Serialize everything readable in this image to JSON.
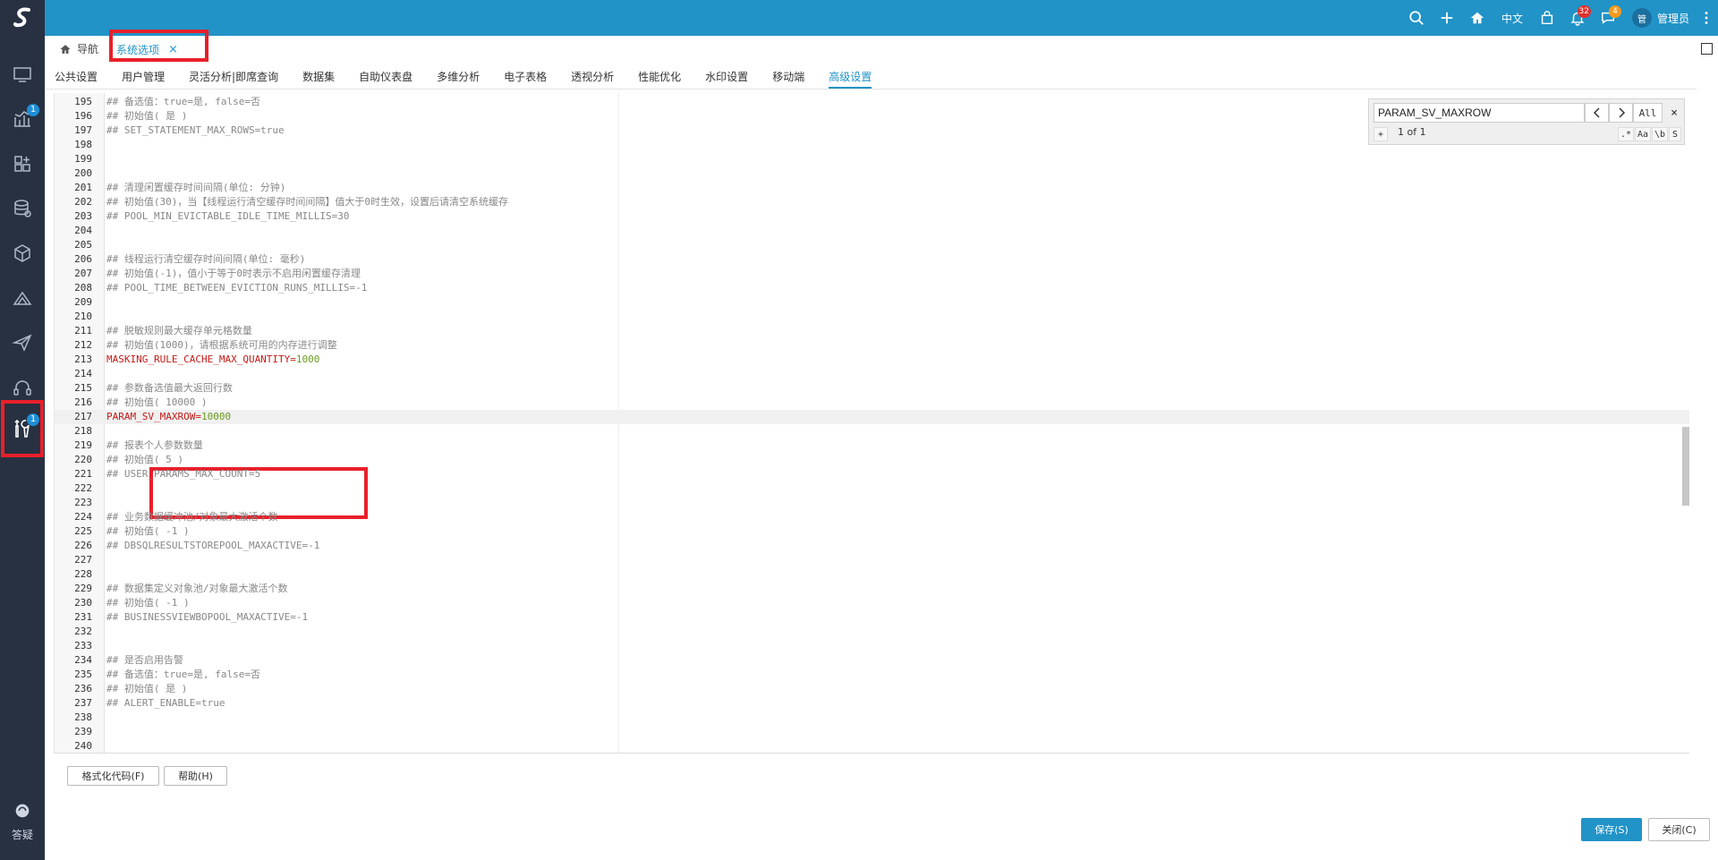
{
  "sidebar": {
    "items": [
      {
        "icon": "monitor-icon",
        "badge": ""
      },
      {
        "icon": "analytics-icon",
        "badge": "1"
      },
      {
        "icon": "grid-plus-icon",
        "badge": ""
      },
      {
        "icon": "database-icon",
        "badge": ""
      },
      {
        "icon": "cube-icon",
        "badge": ""
      },
      {
        "icon": "ruler-icon",
        "badge": ""
      },
      {
        "icon": "send-icon",
        "badge": ""
      },
      {
        "icon": "headset-icon",
        "badge": ""
      },
      {
        "icon": "tools-icon",
        "badge": "1"
      }
    ],
    "help_label": "答疑"
  },
  "topbar": {
    "language": "中文",
    "notifications_badge": "32",
    "messages_badge": "4",
    "avatar_text": "管",
    "user_name": "管理员"
  },
  "breadcrumb": {
    "home_label": "导航",
    "tab_label": "系统选项",
    "tab_close": "×"
  },
  "tabs": [
    "公共设置",
    "用户管理",
    "灵活分析|即席查询",
    "数据集",
    "自助仪表盘",
    "多维分析",
    "电子表格",
    "透视分析",
    "性能优化",
    "水印设置",
    "移动端",
    "高级设置"
  ],
  "active_tab": "高级设置",
  "search": {
    "value": "PARAM_SV_MAXROW",
    "all_label": "All",
    "count": "1 of 1",
    "expand": "+",
    "opt_regex": ".*",
    "opt_case": "Aa",
    "opt_word": "\\b",
    "opt_sel": "S",
    "close": "×"
  },
  "editor_lines": [
    {
      "n": "195",
      "t": "## 备选值：true=是, false=否"
    },
    {
      "n": "196",
      "t": "## 初始值( 是 )"
    },
    {
      "n": "197",
      "t": "## SET_STATEMENT_MAX_ROWS=true"
    },
    {
      "n": "198",
      "t": ""
    },
    {
      "n": "199",
      "t": ""
    },
    {
      "n": "200",
      "t": ""
    },
    {
      "n": "201",
      "t": "## 清理闲置缓存时间间隔(单位: 分钟)"
    },
    {
      "n": "202",
      "t": "## 初始值(30)，当【线程运行清空缓存时间间隔】值大于0时生效，设置后请清空系统缓存"
    },
    {
      "n": "203",
      "t": "## POOL_MIN_EVICTABLE_IDLE_TIME_MILLIS=30"
    },
    {
      "n": "204",
      "t": ""
    },
    {
      "n": "205",
      "t": ""
    },
    {
      "n": "206",
      "t": "## 线程运行清空缓存时间间隔(单位: 毫秒)"
    },
    {
      "n": "207",
      "t": "## 初始值(-1)，值小于等于0时表示不启用闲置缓存清理"
    },
    {
      "n": "208",
      "t": "## POOL_TIME_BETWEEN_EVICTION_RUNS_MILLIS=-1"
    },
    {
      "n": "209",
      "t": ""
    },
    {
      "n": "210",
      "t": ""
    },
    {
      "n": "211",
      "t": "## 脱敏规则最大缓存单元格数量"
    },
    {
      "n": "212",
      "t": "## 初始值(1000)，请根据系统可用的内存进行调整"
    },
    {
      "n": "213",
      "t": "",
      "key": "MASKING_RULE_CACHE_MAX_QUANTITY=",
      "val": "1000"
    },
    {
      "n": "214",
      "t": ""
    },
    {
      "n": "215",
      "t": "## 参数备选值最大返回行数"
    },
    {
      "n": "216",
      "t": "## 初始值( 10000 )"
    },
    {
      "n": "217",
      "t": "",
      "key": "PARAM_SV_MAXROW=",
      "val": "10000"
    },
    {
      "n": "218",
      "t": ""
    },
    {
      "n": "219",
      "t": "## 报表个人参数数量"
    },
    {
      "n": "220",
      "t": "## 初始值( 5 )"
    },
    {
      "n": "221",
      "t": "## USER_PARAMS_MAX_COUNT=5"
    },
    {
      "n": "222",
      "t": ""
    },
    {
      "n": "223",
      "t": ""
    },
    {
      "n": "224",
      "t": "## 业务数据缓冲池/对象最大激活个数"
    },
    {
      "n": "225",
      "t": "## 初始值( -1 )"
    },
    {
      "n": "226",
      "t": "## DBSQLRESULTSTOREPOOL_MAXACTIVE=-1"
    },
    {
      "n": "227",
      "t": ""
    },
    {
      "n": "228",
      "t": ""
    },
    {
      "n": "229",
      "t": "## 数据集定义对象池/对象最大激活个数"
    },
    {
      "n": "230",
      "t": "## 初始值( -1 )"
    },
    {
      "n": "231",
      "t": "## BUSINESSVIEWBOPOOL_MAXACTIVE=-1"
    },
    {
      "n": "232",
      "t": ""
    },
    {
      "n": "233",
      "t": ""
    },
    {
      "n": "234",
      "t": "## 是否启用告警"
    },
    {
      "n": "235",
      "t": "## 备选值：true=是, false=否"
    },
    {
      "n": "236",
      "t": "## 初始值( 是 )"
    },
    {
      "n": "237",
      "t": "## ALERT_ENABLE=true"
    },
    {
      "n": "238",
      "t": ""
    },
    {
      "n": "239",
      "t": ""
    },
    {
      "n": "240",
      "t": ""
    }
  ],
  "bottom": {
    "format_label": "格式化代码(F)",
    "help_label": "帮助(H)",
    "save_label": "保存(S)",
    "close_label": "关闭(C)"
  }
}
